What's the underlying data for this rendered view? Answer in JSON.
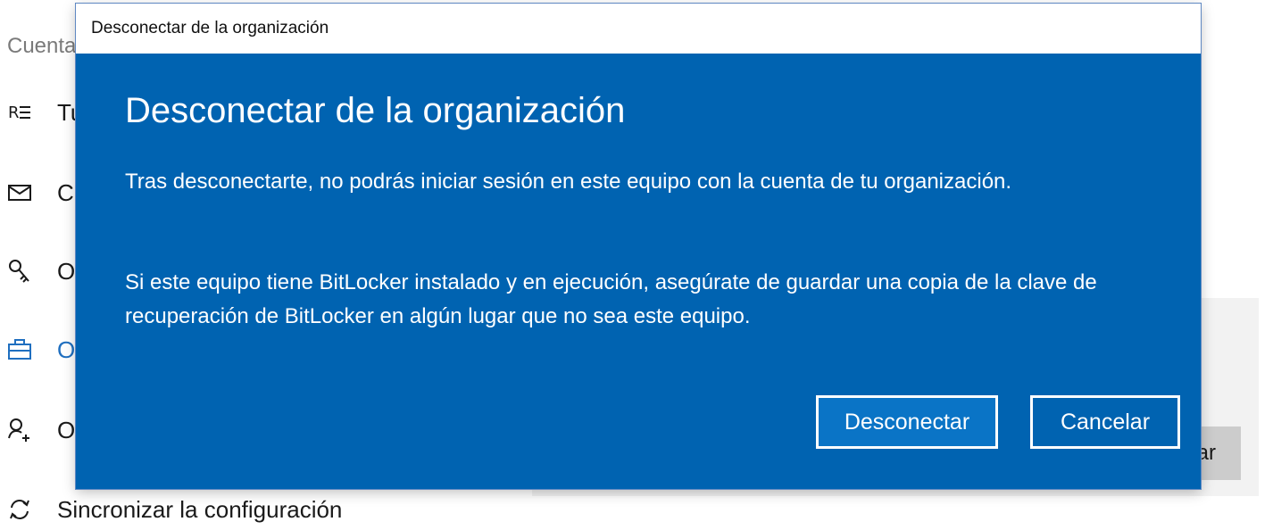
{
  "background": {
    "page_title": "Cuenta",
    "nav_items": [
      {
        "label": "Tu",
        "icon": "user-info-icon",
        "active": false
      },
      {
        "label": "Cu",
        "icon": "mail-icon",
        "active": false
      },
      {
        "label": "O",
        "icon": "key-icon",
        "active": false
      },
      {
        "label": "O",
        "icon": "briefcase-icon",
        "active": true
      },
      {
        "label": "O",
        "icon": "add-person-icon",
        "active": false
      },
      {
        "label": "Sincronizar la configuración",
        "icon": "sync-icon",
        "active": false
      }
    ],
    "button_fragment": "ar",
    "accent_color": "#1f6fc0"
  },
  "dialog": {
    "window_title": "Desconectar de la organización",
    "heading": "Desconectar de la organización",
    "paragraph1": "Tras desconectarte, no podrás iniciar sesión en este equipo con la cuenta de tu organización.",
    "paragraph2": "Si este equipo tiene BitLocker instalado y en ejecución, asegúrate de guardar una copia de la clave de recuperación de BitLocker en algún lugar que no sea este equipo.",
    "primary_button": "Desconectar",
    "secondary_button": "Cancelar",
    "background_color": "#0063b1"
  }
}
